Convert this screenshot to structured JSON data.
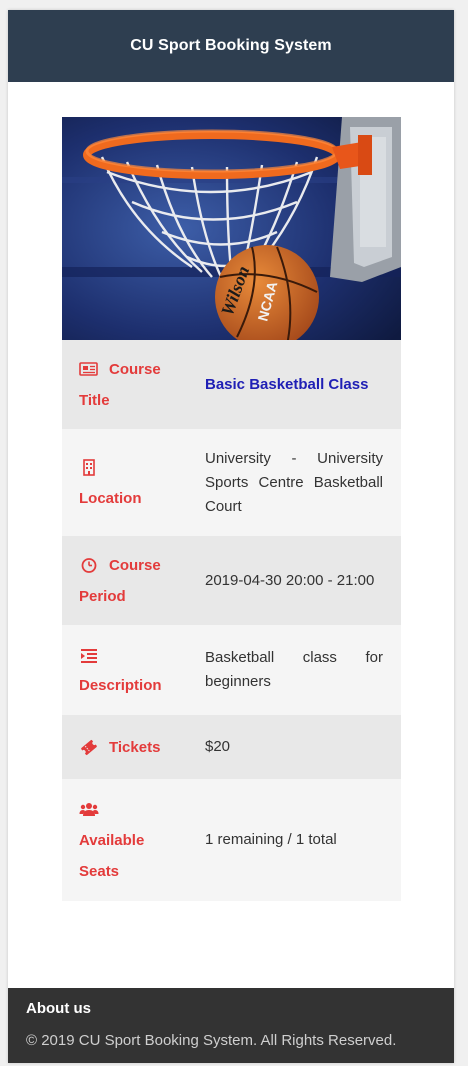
{
  "header": {
    "title": "CU Sport Booking System"
  },
  "hero": {
    "ball_text_1": "Wilson",
    "ball_text_2": "NCAA"
  },
  "course": {
    "title": {
      "label_1": "Course",
      "label_2": "Title",
      "icon": "newspaper-icon",
      "value": "Basic Basketball Class"
    },
    "location": {
      "label": "Location",
      "icon": "building-icon",
      "value": "University - University Sports Centre Basketball Court"
    },
    "period": {
      "label_1": "Course",
      "label_2": "Period",
      "icon": "clock-icon",
      "value": "2019-04-30 20:00 - 21:00"
    },
    "description": {
      "label": "Description",
      "icon": "list-indent-icon",
      "value": "Basketball class for beginners"
    },
    "tickets": {
      "label": "Tickets",
      "icon": "ticket-icon",
      "value": "$20"
    },
    "seats": {
      "label_1": "Available",
      "label_2": "Seats",
      "icon": "users-icon",
      "value": "1 remaining / 1 total"
    }
  },
  "footer": {
    "about": "About us",
    "copyright": "© 2019 CU Sport Booking System. All Rights Reserved."
  },
  "colors": {
    "header_bg": "#2e3e50",
    "label_red": "#e33b3b",
    "title_blue": "#1f1fb5",
    "footer_bg": "#333333"
  }
}
